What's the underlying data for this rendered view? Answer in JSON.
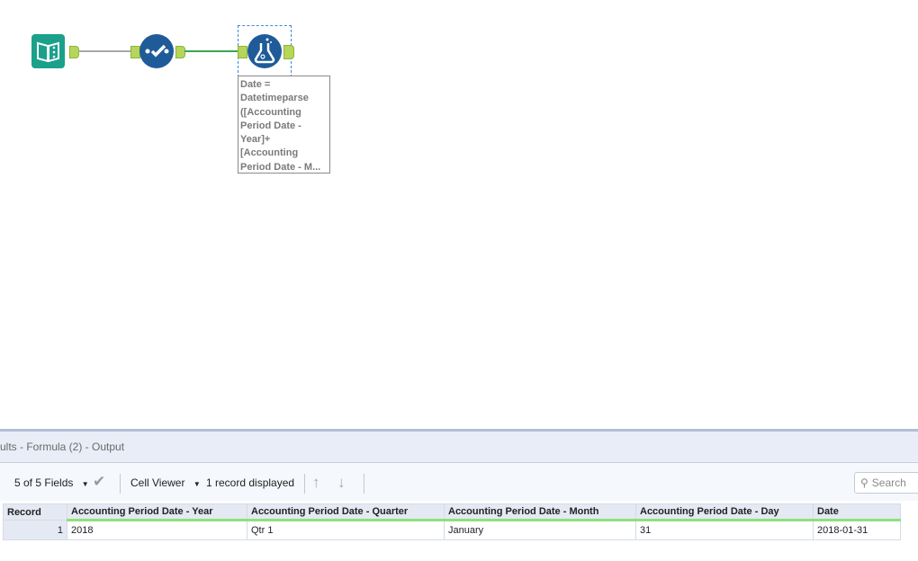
{
  "canvas": {
    "tools": [
      {
        "name": "input-data",
        "icon": "book-icon"
      },
      {
        "name": "select",
        "icon": "check-icon"
      },
      {
        "name": "formula",
        "icon": "flask-icon"
      }
    ],
    "annotation": "Date =\nDatetimeparse\n([Accounting\nPeriod Date -\nYear]+\n[Accounting\nPeriod Date - M..."
  },
  "results": {
    "title": "ults - Formula (2) - Output",
    "fields_label": "5 of 5 Fields",
    "cell_viewer_label": "Cell Viewer",
    "record_count": "1 record displayed",
    "search_placeholder": "Search",
    "columns": [
      "Record",
      "Accounting Period Date - Year",
      "Accounting Period Date - Quarter",
      "Accounting Period Date - Month",
      "Accounting Period Date - Day",
      "Date"
    ],
    "rows": [
      [
        "1",
        "2018",
        "Qtr 1",
        "January",
        "31",
        "2018-01-31"
      ]
    ]
  },
  "colors": {
    "accent": "#1f5b99",
    "input": "#1a9e8a",
    "connector": "#b5d65a"
  }
}
